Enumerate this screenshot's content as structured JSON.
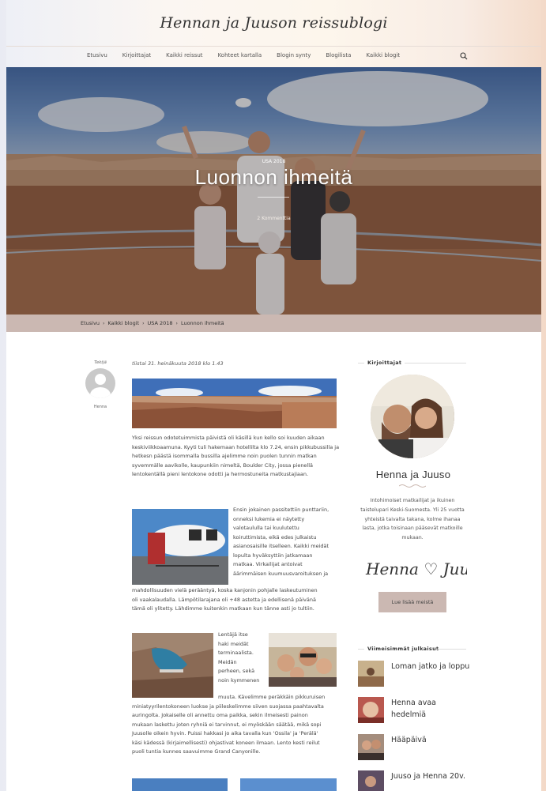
{
  "site": {
    "title": "Hennan ja Juuson reissublogi"
  },
  "nav": {
    "items": [
      "Etusivu",
      "Kirjoittajat",
      "Kaikki reissut",
      "Kohteet kartalla",
      "Blogin synty",
      "Blogilista",
      "Kaikki blogit"
    ],
    "search_icon": "search-icon"
  },
  "hero": {
    "category": "USA 2018",
    "title": "Luonnon ihmeitä",
    "comments": "2 Kommenttia"
  },
  "breadcrumb": {
    "items": [
      "Etusivu",
      "Kaikki blogit",
      "USA 2018",
      "Luonnon ihmeitä"
    ],
    "separator": "›"
  },
  "post": {
    "author_label": "Tekijä",
    "author_name": "Henna",
    "date": "tiistai 31. heinäkuuta 2018 klo 1.43",
    "paragraphs": [
      "Yksi reissun odotetuimmista päivistä oli käsillä kun kello soi kuuden aikaan keskiviikkoaamuna. Kyyti tuli hakemaan hotellilta klo 7.24, ensin pikkubussilla ja hetkesn päästä isommalla bussilla ajelimme noin puolen tunnin matkan syvemmälle aavikolle, kaupunkiin nimeltä, Boulder City, jossa pienellä lentokentällä pieni lentokone odotti ja hermostuneita matkustajiaan.",
      "Ensin jokainen passitettiin punttariin, onneksi lukemia ei näytetty valotaululla tai kuulutettu koiruttimista, eikä edes julkaistu asianosaisille itselleen. Kaikki meidät lopulta hyväksyttiin jatkamaan matkaa. Virkailijat antoivat äärimmäisen kuumuusvaroituksen ja mahdollisuuden vielä perääntyä, koska kanjonin pohjalle laskeutuminen oli vaakalaudalla. Lämpötilarajana oli +48 astetta ja edellisenä päivänä tämä oli ylitetty. Lähdimme kuitenkin matkaan kun tänne asti jo tultiin.",
      "Lentäjä itse haki meidät terminaalista. Meidän perheen, sekä noin kymmenen muuta. Kävelimme peräkkäin pikkuruisen miniatyyrilentokoneen luokse ja piileskelimme siiven suojassa paahtavalta auringolta. Jokaiselle oli annettu oma paikka, sekin ilmeisesti painon mukaan laskettu joten ryhniä ei tarvinnut, ei myöskään säätää, mikä sopi Juusolle oikein hyvin. Puissi hakkasi jo aika tavalla kun 'Ossila' ja 'Perälä' käsi kädessä (kirjaimellisesti) ohjastivat koneen ilmaan. Lento kesti reilut puoli tuntia kunnes saavuimme Grand Canyonille."
    ],
    "para2_lines": [
      "Ensin jokainen passitettiin punttariin,",
      "onneksi lukemia ei näytetty",
      "valotaululla tai kuulutettu",
      "koiruttimista, eikä edes julkaistu",
      "asianosaisille itselleen. Kaikki meidät",
      "lopulta hyväksyttiin jatkamaan",
      "matkaa. Virkailijat antoivat",
      "äärimmäisen kuumuusvaroituksen ja",
      "mahdollisuuden vielä perääntyä, koska kanjonin pohjalle laskeutuminen",
      "oli vaakalaudalla. Lämpötilarajana oli +48 astetta ja edellisenä päivänä",
      "tämä oli ylitetty. Lähdimme kuitenkin matkaan kun tänne asti jo tultiin."
    ],
    "para3_lines": [
      "Lentäjä itse",
      "haki meidät",
      "terminaalista.",
      "Meidän",
      "perheen, sekä",
      "noin kymmenen",
      "muuta. Kävelimme peräkkäin pikkuruisen",
      "miniatyyrilentokoneen luokse ja piileskelimme siiven suojassa paahtavalta",
      "auringolta. Jokaiselle oli annettu oma paikka, sekin ilmeisesti painon",
      "mukaan laskettu joten ryhniä ei tarvinnut, ei myöskään säätää, mikä sopi",
      "Juusolle oikein hyvin. Puissi hakkasi jo aika tavalla kun 'Ossila' ja 'Perälä'",
      "käsi kädessä (kirjaimellisesti) ohjastivat koneen ilmaan. Lento kesti reilut",
      "puoli tuntia kunnes saavuimme Grand Canyonille."
    ]
  },
  "sidebar": {
    "authors_heading": "Kirjoittajat",
    "authors_title": "Henna ja Juuso",
    "authors_desc": "Intohimoiset matkailijat ja ikuinen taistelupari Keski-Suomesta. Yli 25 vuotta yhteistä taivalta takana, kolme ihanaa lasta, jotka toisinaan pääsevät matkoille mukaan.",
    "signature": "Henna ♡ Juuso",
    "read_more": "Lue lisää meistä",
    "recent_heading": "Viimeisimmät julkaisut",
    "recent": [
      "Loman jatko ja loppu",
      "Henna avaa hedelmiä",
      "Hääpäivä",
      "Juuso ja Henna 20v."
    ]
  },
  "colors": {
    "accent": "#cbb8b2",
    "text": "#444444"
  }
}
